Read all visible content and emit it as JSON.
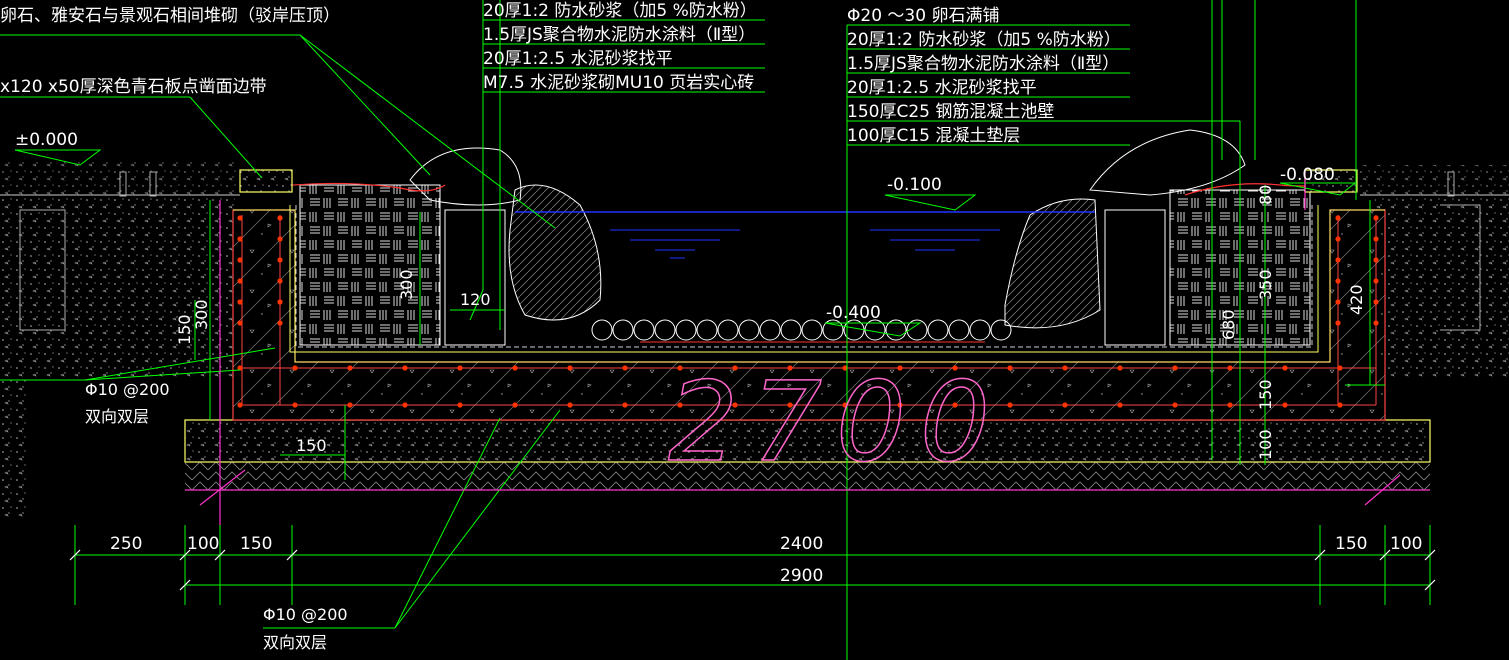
{
  "colors": {
    "background": "#000000",
    "leader": "#00ff00",
    "text": "#ffffff",
    "rebar": "#ff3300",
    "concrete_edge": "#ff4444",
    "water": "#2233ff",
    "cushion": "#ffff66",
    "magenta": "#ff33cc",
    "pink": "#ff66cc",
    "hatch": "#bbbbbb",
    "dim_line": "#00ff00"
  },
  "callouts": {
    "top_left_stone": "卵石、雅安石与景观石相间堆砌（驳岸压顶）",
    "edge_band": "x120 x50厚深色青石板点凿面边带",
    "datum_zero": "±0.000",
    "rebar_left": {
      "spec": "Φ10 @200",
      "note": "双向双层"
    },
    "rebar_bottom": {
      "spec": "Φ10 @200",
      "note": "双向双层"
    }
  },
  "layers_left": [
    "20厚1:2 防水砂浆（加5 %防水粉）",
    "1.5厚JS聚合物水泥防水涂料（Ⅱ型）",
    "20厚1:2.5 水泥砂浆找平",
    "M7.5 水泥砂浆砌MU10 页岩实心砖"
  ],
  "layers_right": [
    "Φ20 ～30 卵石满铺",
    "20厚1:2 防水砂浆（加5 %防水粉）",
    "1.5厚JS聚合物水泥防水涂料（Ⅱ型）",
    "20厚1:2.5 水泥砂浆找平",
    "150厚C25 钢筋混凝土池壁",
    "100厚C15 混凝土垫层"
  ],
  "elevations": {
    "water_level": "-0.100",
    "bottom": "-0.400",
    "right_edge": "-0.080"
  },
  "inner_dims": {
    "brick_height": "300",
    "brick_width": "120",
    "left_150": "150",
    "left_300": "300",
    "bottom_150": "150",
    "right_80": "80",
    "right_350": "350",
    "right_680": "680",
    "right_420": "420",
    "right_150": "150",
    "right_100": "100"
  },
  "handwritten": "2700",
  "bottom_dims": {
    "row1": [
      "250",
      "100",
      "150",
      "2400",
      "150",
      "100"
    ],
    "total": "2900"
  }
}
